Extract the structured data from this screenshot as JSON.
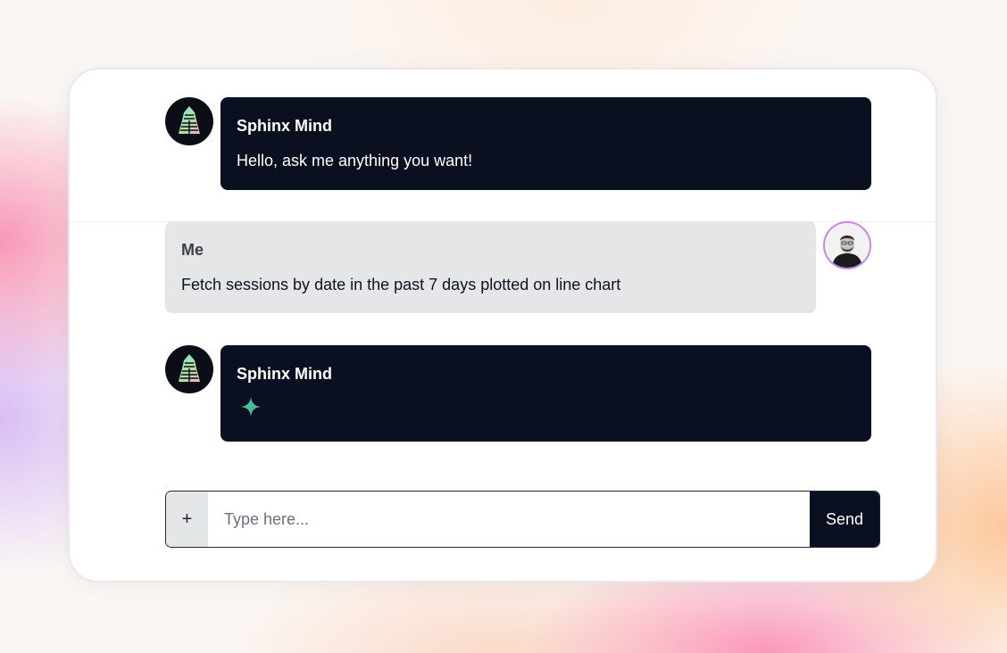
{
  "app": {
    "bot_name": "Sphinx Mind"
  },
  "messages": [
    {
      "role": "bot",
      "sender": "Sphinx Mind",
      "text": "Hello, ask me anything you want!"
    },
    {
      "role": "user",
      "sender": "Me",
      "text": "Fetch sessions by date in the past 7 days plotted on line chart"
    },
    {
      "role": "bot",
      "sender": "Sphinx Mind",
      "text": "",
      "status": "loading",
      "icon": "sparkle-icon"
    }
  ],
  "composer": {
    "attach_label": "+",
    "placeholder": "Type here...",
    "value": "",
    "send_label": "Send"
  },
  "colors": {
    "bot_bubble": "#0b1020",
    "user_bubble": "#e5e6e8",
    "user_avatar_ring": "#c687e6",
    "send_button": "#0b1020"
  }
}
